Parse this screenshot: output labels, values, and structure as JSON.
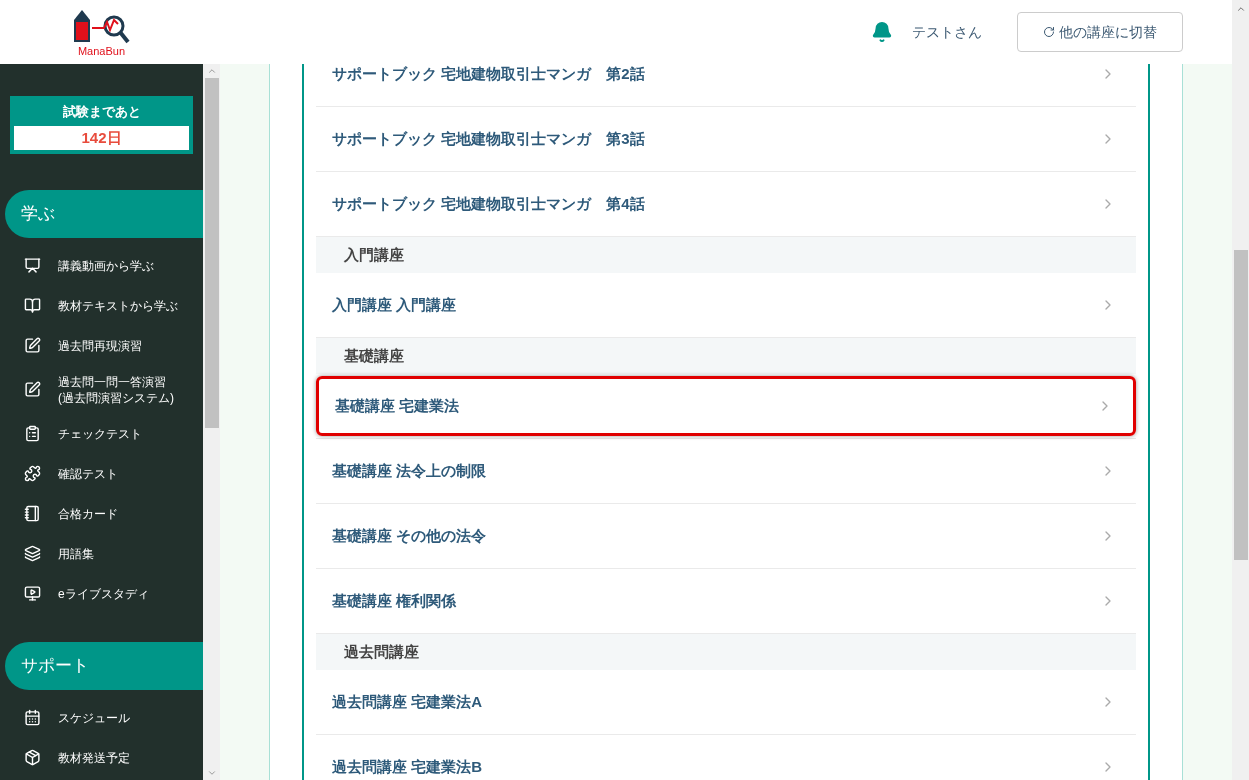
{
  "header": {
    "logo": "ManaBun",
    "user": "テストさん",
    "switch_button": "他の講座に切替"
  },
  "sidebar": {
    "countdown": {
      "label": "試験まであと",
      "value": "142日"
    },
    "sections": [
      {
        "title": "学ぶ",
        "items": [
          {
            "label": "講義動画から学ぶ"
          },
          {
            "label": "教材テキストから学ぶ"
          },
          {
            "label": "過去問再現演習"
          },
          {
            "label": "過去問一問一答演習\n(過去問演習システム)"
          },
          {
            "label": "チェックテスト"
          },
          {
            "label": "確認テスト"
          },
          {
            "label": "合格カード"
          },
          {
            "label": "用語集"
          },
          {
            "label": "eライブスタディ"
          }
        ]
      },
      {
        "title": "サポート",
        "items": [
          {
            "label": "スケジュール"
          },
          {
            "label": "教材発送予定"
          }
        ]
      }
    ]
  },
  "list": [
    {
      "kind": "item",
      "label": "サポートブック 宅地建物取引士マンガ　第2話",
      "highlighted": false
    },
    {
      "kind": "item",
      "label": "サポートブック 宅地建物取引士マンガ　第3話",
      "highlighted": false
    },
    {
      "kind": "item",
      "label": "サポートブック 宅地建物取引士マンガ　第4話",
      "highlighted": false
    },
    {
      "kind": "section",
      "label": "入門講座"
    },
    {
      "kind": "item",
      "label": "入門講座 入門講座",
      "highlighted": false
    },
    {
      "kind": "section",
      "label": "基礎講座"
    },
    {
      "kind": "item",
      "label": "基礎講座 宅建業法",
      "highlighted": true
    },
    {
      "kind": "item",
      "label": "基礎講座 法令上の制限",
      "highlighted": false
    },
    {
      "kind": "item",
      "label": "基礎講座 その他の法令",
      "highlighted": false
    },
    {
      "kind": "item",
      "label": "基礎講座 権利関係",
      "highlighted": false
    },
    {
      "kind": "section",
      "label": "過去問講座"
    },
    {
      "kind": "item",
      "label": "過去問講座 宅建業法A",
      "highlighted": false
    },
    {
      "kind": "item",
      "label": "過去問講座 宅建業法B",
      "highlighted": false
    }
  ]
}
